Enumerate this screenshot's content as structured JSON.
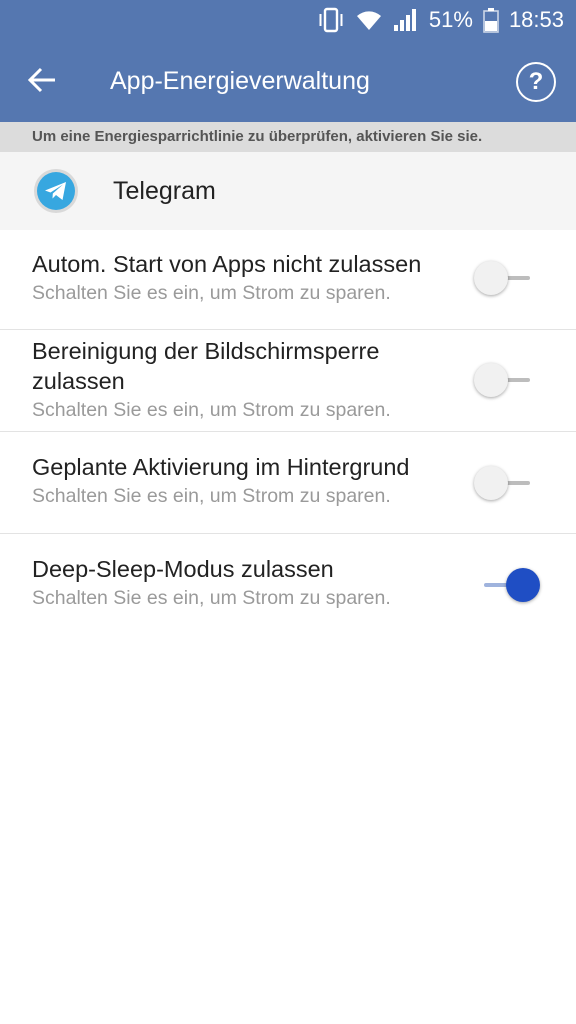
{
  "status_bar": {
    "battery_percent": "51%",
    "time": "18:53",
    "icons": [
      "vibrate-icon",
      "wifi-icon",
      "signal-icon",
      "battery-icon"
    ]
  },
  "toolbar": {
    "title": "App-Energieverwaltung",
    "back_icon": "back-arrow-icon",
    "help_label": "?"
  },
  "hint": "Um eine Energiesparrichtlinie zu überprüfen, aktivieren Sie sie.",
  "app": {
    "name": "Telegram",
    "icon": "telegram-icon"
  },
  "settings": [
    {
      "title": "Autom. Start von Apps nicht zulassen",
      "subtitle": "Schalten Sie es ein, um Strom zu sparen.",
      "enabled": false
    },
    {
      "title": "Bereinigung der Bildschirmsperre zulassen",
      "subtitle": "Schalten Sie es ein, um Strom zu sparen.",
      "enabled": false
    },
    {
      "title": "Geplante Aktivierung im Hintergrund",
      "subtitle": "Schalten Sie es ein, um Strom zu sparen.",
      "enabled": false
    },
    {
      "title": "Deep-Sleep-Modus zulassen",
      "subtitle": "Schalten Sie es ein, um Strom zu sparen.",
      "enabled": true
    }
  ],
  "colors": {
    "header": "#5577b0",
    "toggle_on": "#1f4ec4",
    "banner": "#dcdcdc"
  }
}
